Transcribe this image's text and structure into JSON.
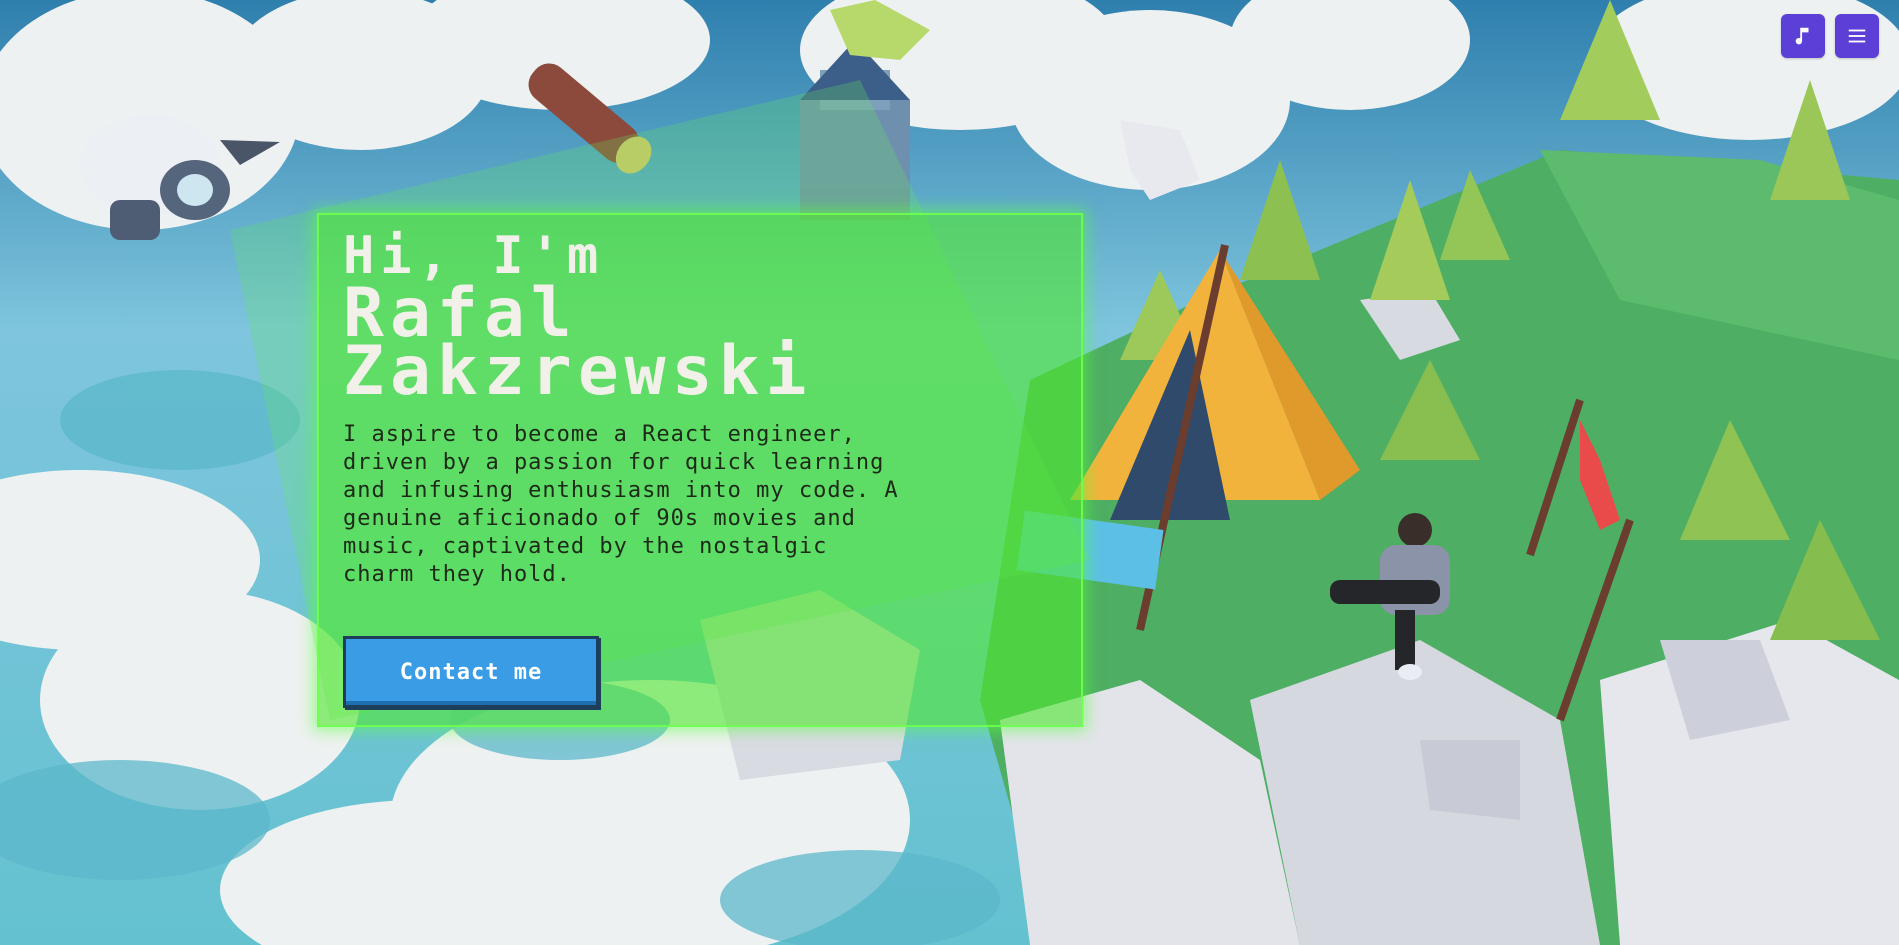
{
  "header": {
    "music_icon": "music-note-icon",
    "menu_icon": "hamburger-menu-icon",
    "accent_color": "#5b3fd6"
  },
  "hero": {
    "greeting": "Hi, I'm",
    "name_line1": "Rafal",
    "name_line2": "Zakzrewski",
    "bio_lines": [
      "I aspire to become a React engineer,",
      "driven by a passion for quick learning",
      "and infusing enthusiasm into my code. A",
      "genuine aficionado of 90s movies and",
      "music, captivated by the nostalgic",
      "charm they hold."
    ],
    "contact_label": "Contact me",
    "panel_color": "#50e632",
    "button_color": "#3b9ce6"
  },
  "scene": {
    "description_icons": [
      "airship",
      "floating-island",
      "tent",
      "avatar",
      "trees",
      "log",
      "castle"
    ]
  }
}
